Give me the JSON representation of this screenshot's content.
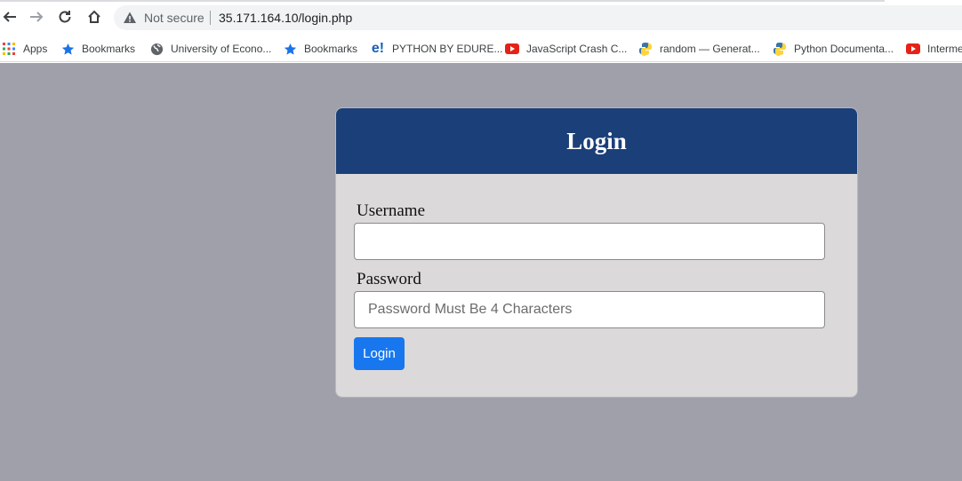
{
  "browser": {
    "security_label": "Not secure",
    "url": "35.171.164.10/login.php"
  },
  "bookmarks": [
    {
      "label": "Apps",
      "icon": "apps-grid-icon"
    },
    {
      "label": "Bookmarks",
      "icon": "star-icon"
    },
    {
      "label": "University of Econo...",
      "icon": "globe-icon"
    },
    {
      "label": "Bookmarks",
      "icon": "star-icon"
    },
    {
      "label": "PYTHON BY EDURE...",
      "icon": "edureka-icon"
    },
    {
      "label": "JavaScript Crash C...",
      "icon": "youtube-icon"
    },
    {
      "label": "random — Generat...",
      "icon": "python-icon"
    },
    {
      "label": "Python Documenta...",
      "icon": "python-icon"
    },
    {
      "label": "Interme",
      "icon": "youtube-icon"
    }
  ],
  "login": {
    "title": "Login",
    "username_label": "Username",
    "username_value": "",
    "password_label": "Password",
    "password_placeholder": "Password Must Be 4 Characters",
    "button_label": "Login"
  },
  "colors": {
    "header": "#1b3f78",
    "page_bg": "#a0a0ab",
    "card_bg": "#dcd9da",
    "button": "#1877ee"
  }
}
